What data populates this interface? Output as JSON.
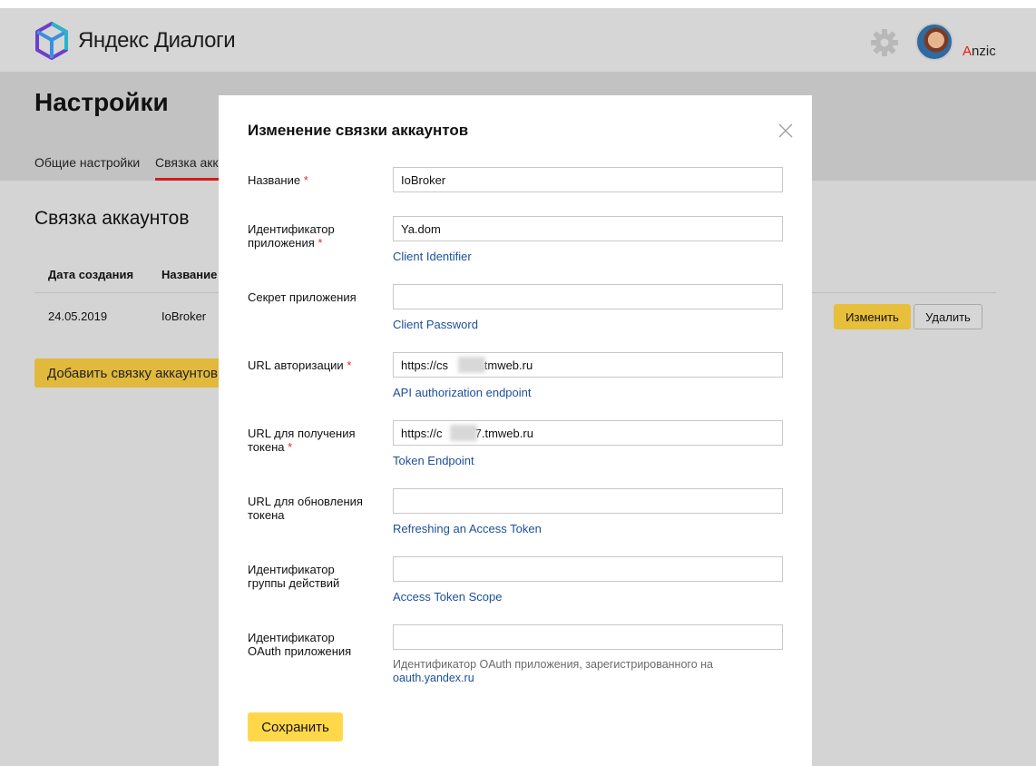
{
  "header": {
    "logo_text": "Яндекс Диалоги",
    "username_first": "A",
    "username_rest": "nzic"
  },
  "page": {
    "title": "Настройки",
    "tabs": [
      {
        "label": "Общие настройки",
        "active": false
      },
      {
        "label": "Связка акка",
        "active": true
      }
    ]
  },
  "section": {
    "title": "Связка аккаунтов",
    "columns": [
      "Дата создания",
      "Название"
    ],
    "rows": [
      {
        "date": "24.05.2019",
        "name": "IoBroker",
        "edit_label": "Изменить",
        "delete_label": "Удалить"
      }
    ],
    "add_button": "Добавить связку аккаунтов"
  },
  "modal": {
    "title": "Изменение связки аккаунтов",
    "required_mark": "*",
    "fields": [
      {
        "label": "Название",
        "required": true,
        "value": "IoBroker",
        "hint": ""
      },
      {
        "label": "Идентификатор приложения",
        "required": true,
        "value": "Ya.dom",
        "hint": "Client Identifier"
      },
      {
        "label": "Секрет приложения",
        "required": false,
        "value": "",
        "hint": "Client Password"
      },
      {
        "label": "URL авторизации",
        "required": true,
        "value": "https://cs          .tmweb.ru",
        "hint": "API authorization endpoint"
      },
      {
        "label": "URL для получения токена",
        "required": true,
        "value": "https://c          7.tmweb.ru",
        "hint": "Token Endpoint"
      },
      {
        "label": "URL для обновления токена",
        "required": false,
        "value": "",
        "hint": "Refreshing an Access Token"
      },
      {
        "label": "Идентификатор группы действий",
        "required": false,
        "value": "",
        "hint": "Access Token Scope"
      },
      {
        "label": "Идентификатор OAuth приложения",
        "required": false,
        "value": "",
        "hint_text": "Идентификатор OAuth приложения, зарегистрированного на",
        "hint_link": "oauth.yandex.ru"
      }
    ],
    "save_button": "Сохранить"
  },
  "colors": {
    "accent_yellow": "#ffd84a",
    "link_blue": "#1c4f9c",
    "required_red": "#e52b2b",
    "tab_red": "#d41b1b"
  }
}
